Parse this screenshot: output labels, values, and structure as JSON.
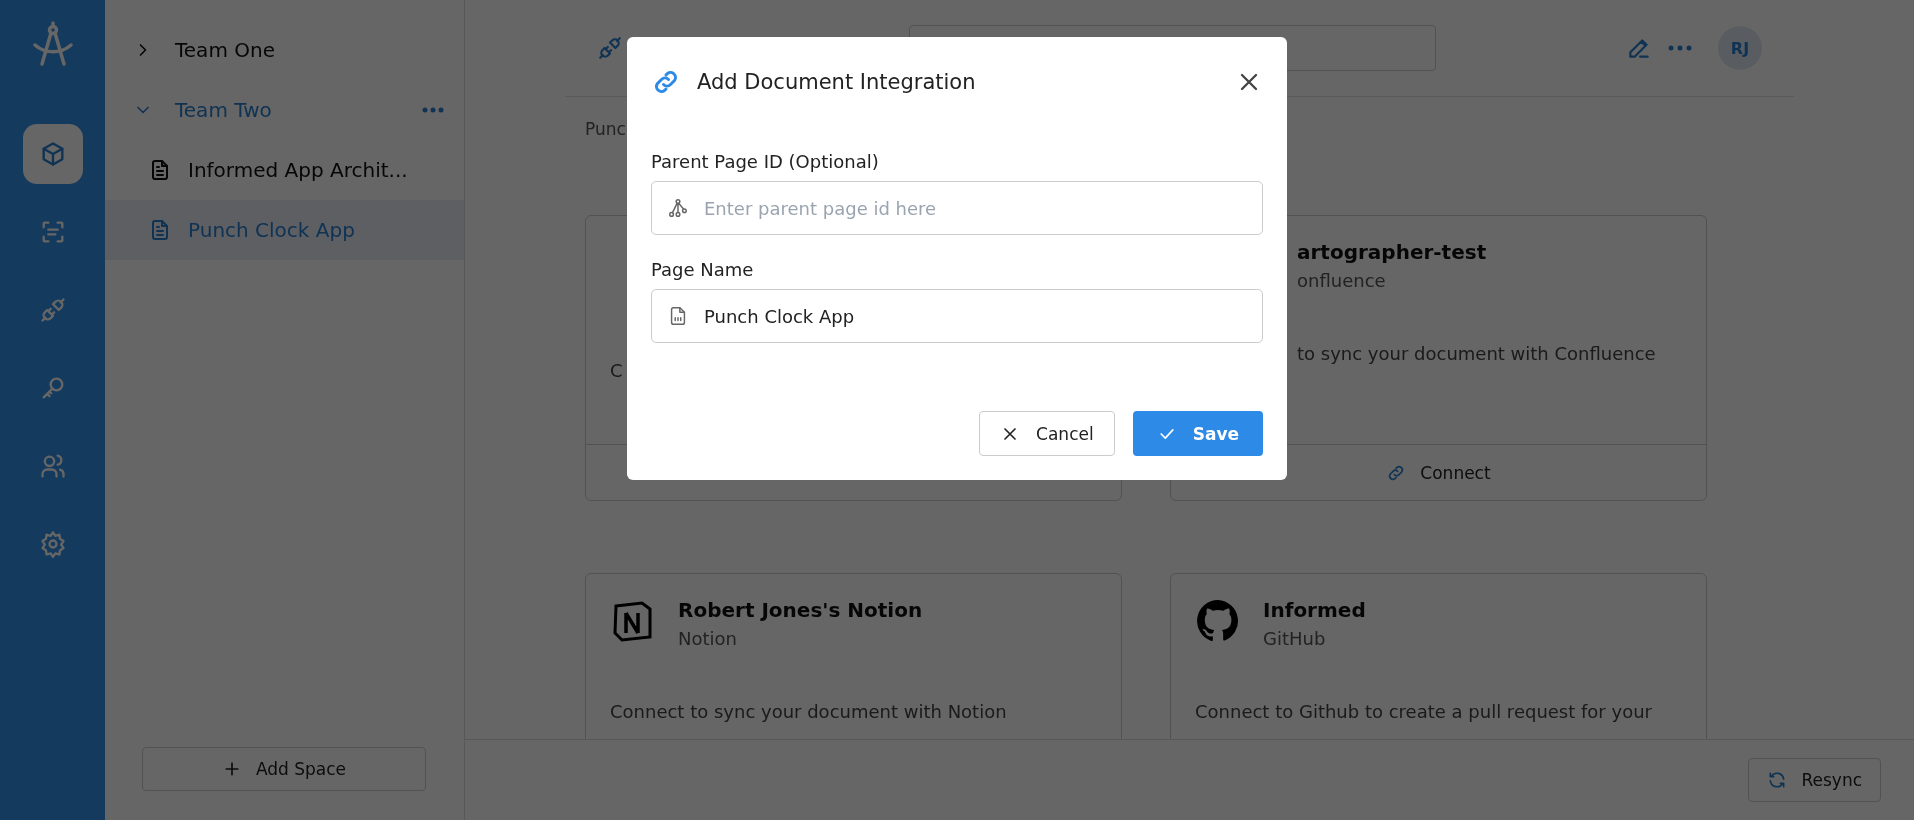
{
  "rail": {
    "items": [
      {
        "kind": "cube",
        "selected": true
      },
      {
        "kind": "scan",
        "selected": false
      },
      {
        "kind": "plug",
        "selected": false
      },
      {
        "kind": "key",
        "selected": false
      },
      {
        "kind": "users",
        "selected": false
      },
      {
        "kind": "gear",
        "selected": false
      }
    ]
  },
  "sidebar": {
    "teams": [
      {
        "label": "Team One",
        "expanded": false
      },
      {
        "label": "Team Two",
        "expanded": true,
        "children": [
          {
            "label": "Informed App Archit...",
            "selected": false
          },
          {
            "label": "Punch Clock App",
            "selected": true
          }
        ]
      }
    ],
    "add_button": "Add Space"
  },
  "header": {
    "avatar": "RJ"
  },
  "breadcrumb": "Punc",
  "cards": [
    {
      "kind": "covered",
      "description": "C"
    },
    {
      "kind": "confluence",
      "title": "artographer-test",
      "subtitle": "onfluence",
      "description": "to sync your document with Confluence",
      "action": "Connect"
    },
    {
      "kind": "notion",
      "title": "Robert Jones's Notion",
      "subtitle": "Notion",
      "description": "Connect to sync your document with Notion"
    },
    {
      "kind": "github",
      "title": "Informed",
      "subtitle": "GitHub",
      "description": "Connect to Github to create a pull request for your"
    }
  ],
  "footer": {
    "resync": "Resync"
  },
  "dialog": {
    "title": "Add Document Integration",
    "fields": [
      {
        "label": "Parent Page ID (Optional)",
        "placeholder": "Enter parent page id here",
        "kind": "tree"
      },
      {
        "label": "Page Name",
        "value": "Punch Clock App",
        "kind": "file"
      }
    ],
    "cancel": "Cancel",
    "save": "Save"
  }
}
